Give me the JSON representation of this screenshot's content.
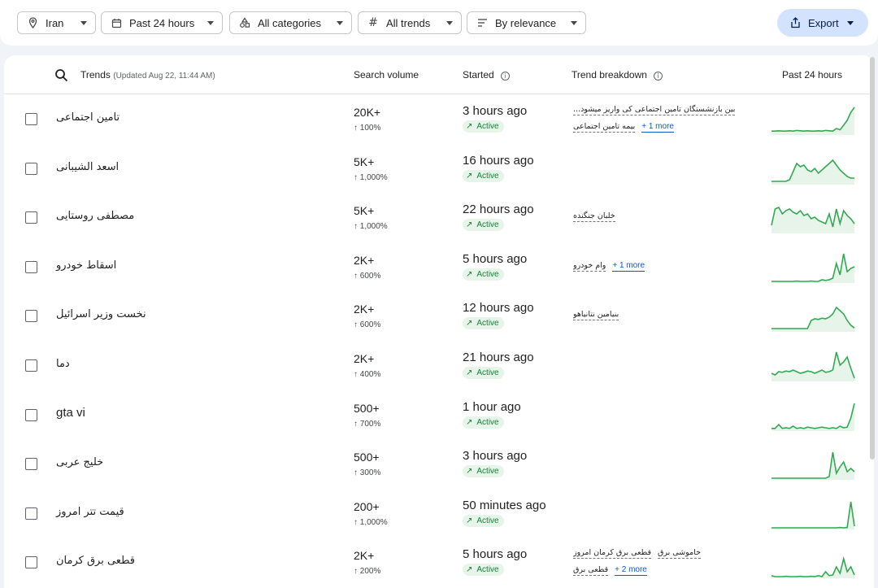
{
  "filters": {
    "geo": "Iran",
    "time": "Past 24 hours",
    "category": "All categories",
    "trends": "All trends",
    "sort": "By relevance",
    "export": "Export"
  },
  "header": {
    "trends": "Trends",
    "updated": "(Updated Aug 22, 11:44 AM)",
    "search_volume": "Search volume",
    "started": "Started",
    "breakdown": "Trend breakdown",
    "past": "Past 24 hours"
  },
  "colors": {
    "accent": "#0b57d0",
    "active_bg": "#e6f4ea",
    "active_fg": "#188038",
    "spark": "#34a853",
    "export_bg": "#d3e3fd"
  },
  "rows": [
    {
      "name": "تامین اجتماعی",
      "volume": "20K+",
      "pct": "↑ 100%",
      "started": "3 hours ago",
      "status": "Active",
      "breakdown": [
        "...بین بازنشستگان تامین اجتماعی کی واریز میشود",
        "بیمه تامین اجتماعی"
      ],
      "more": "+ 1 more"
    },
    {
      "name": "اسعد الشیبانی",
      "volume": "5K+",
      "pct": "↑ 1,000%",
      "started": "16 hours ago",
      "status": "Active",
      "breakdown": [],
      "more": ""
    },
    {
      "name": "مصطفی روستایی",
      "volume": "5K+",
      "pct": "↑ 1,000%",
      "started": "22 hours ago",
      "status": "Active",
      "breakdown": [
        "خلبان جنگنده"
      ],
      "more": ""
    },
    {
      "name": "اسقاط خودرو",
      "volume": "2K+",
      "pct": "↑ 600%",
      "started": "5 hours ago",
      "status": "Active",
      "breakdown": [
        "وام خودرو"
      ],
      "more": "+ 1 more"
    },
    {
      "name": "نخست وزیر اسرائیل",
      "volume": "2K+",
      "pct": "↑ 600%",
      "started": "12 hours ago",
      "status": "Active",
      "breakdown": [
        "بنیامین نتانیاهو"
      ],
      "more": ""
    },
    {
      "name": "دما",
      "volume": "2K+",
      "pct": "↑ 400%",
      "started": "21 hours ago",
      "status": "Active",
      "breakdown": [],
      "more": ""
    },
    {
      "name": "gta vi",
      "volume": "500+",
      "pct": "↑ 700%",
      "started": "1 hour ago",
      "status": "Active",
      "breakdown": [],
      "more": ""
    },
    {
      "name": "خلیج عربی",
      "volume": "500+",
      "pct": "↑ 300%",
      "started": "3 hours ago",
      "status": "Active",
      "breakdown": [],
      "more": ""
    },
    {
      "name": "قیمت تتر امروز",
      "volume": "200+",
      "pct": "↑ 1,000%",
      "started": "50 minutes ago",
      "status": "Active",
      "breakdown": [],
      "more": ""
    },
    {
      "name": "قطعی برق کرمان",
      "volume": "2K+",
      "pct": "↑ 200%",
      "started": "5 hours ago",
      "status": "Active",
      "breakdown": [
        "خاموشی برق",
        "قطعی برق کرمان امروز",
        "قطعی برق"
      ],
      "more": "+ 2 more"
    }
  ],
  "sparklines": [
    [
      0.12,
      0.12,
      0.13,
      0.12,
      0.12,
      0.13,
      0.12,
      0.14,
      0.13,
      0.12,
      0.13,
      0.12,
      0.12,
      0.13,
      0.12,
      0.14,
      0.13,
      0.12,
      0.2,
      0.16,
      0.3,
      0.45,
      0.7,
      0.85
    ],
    [
      0.1,
      0.1,
      0.1,
      0.1,
      0.1,
      0.15,
      0.4,
      0.65,
      0.55,
      0.6,
      0.45,
      0.4,
      0.5,
      0.35,
      0.45,
      0.55,
      0.65,
      0.75,
      0.6,
      0.45,
      0.35,
      0.25,
      0.2,
      0.2
    ],
    [
      0.25,
      0.75,
      0.8,
      0.6,
      0.7,
      0.75,
      0.65,
      0.6,
      0.7,
      0.55,
      0.6,
      0.45,
      0.5,
      0.4,
      0.35,
      0.3,
      0.6,
      0.2,
      0.75,
      0.3,
      0.7,
      0.55,
      0.45,
      0.3
    ],
    [
      0.05,
      0.05,
      0.05,
      0.05,
      0.05,
      0.05,
      0.05,
      0.06,
      0.05,
      0.05,
      0.05,
      0.06,
      0.05,
      0.05,
      0.1,
      0.08,
      0.1,
      0.15,
      0.6,
      0.25,
      0.9,
      0.35,
      0.45,
      0.5
    ],
    [
      0.1,
      0.1,
      0.1,
      0.1,
      0.1,
      0.1,
      0.1,
      0.1,
      0.1,
      0.1,
      0.1,
      0.35,
      0.4,
      0.38,
      0.42,
      0.4,
      0.45,
      0.55,
      0.75,
      0.65,
      0.55,
      0.35,
      0.2,
      0.12
    ],
    [
      0.25,
      0.2,
      0.3,
      0.28,
      0.32,
      0.3,
      0.35,
      0.3,
      0.25,
      0.28,
      0.32,
      0.3,
      0.25,
      0.3,
      0.35,
      0.28,
      0.3,
      0.35,
      0.9,
      0.5,
      0.6,
      0.75,
      0.4,
      0.1
    ],
    [
      0.08,
      0.08,
      0.2,
      0.08,
      0.1,
      0.08,
      0.15,
      0.08,
      0.1,
      0.08,
      0.12,
      0.1,
      0.08,
      0.1,
      0.12,
      0.1,
      0.08,
      0.1,
      0.08,
      0.15,
      0.1,
      0.12,
      0.4,
      0.85
    ],
    [
      0.05,
      0.05,
      0.05,
      0.05,
      0.05,
      0.05,
      0.05,
      0.05,
      0.05,
      0.05,
      0.05,
      0.05,
      0.05,
      0.05,
      0.05,
      0.05,
      0.1,
      0.85,
      0.2,
      0.4,
      0.55,
      0.25,
      0.35,
      0.25
    ],
    [
      0.05,
      0.05,
      0.05,
      0.05,
      0.05,
      0.05,
      0.05,
      0.05,
      0.05,
      0.05,
      0.05,
      0.05,
      0.05,
      0.05,
      0.05,
      0.05,
      0.05,
      0.05,
      0.05,
      0.06,
      0.05,
      0.06,
      0.85,
      0.1
    ],
    [
      0.08,
      0.05,
      0.05,
      0.05,
      0.06,
      0.05,
      0.05,
      0.05,
      0.06,
      0.05,
      0.05,
      0.06,
      0.05,
      0.08,
      0.05,
      0.2,
      0.08,
      0.1,
      0.35,
      0.15,
      0.6,
      0.2,
      0.35,
      0.1
    ]
  ]
}
